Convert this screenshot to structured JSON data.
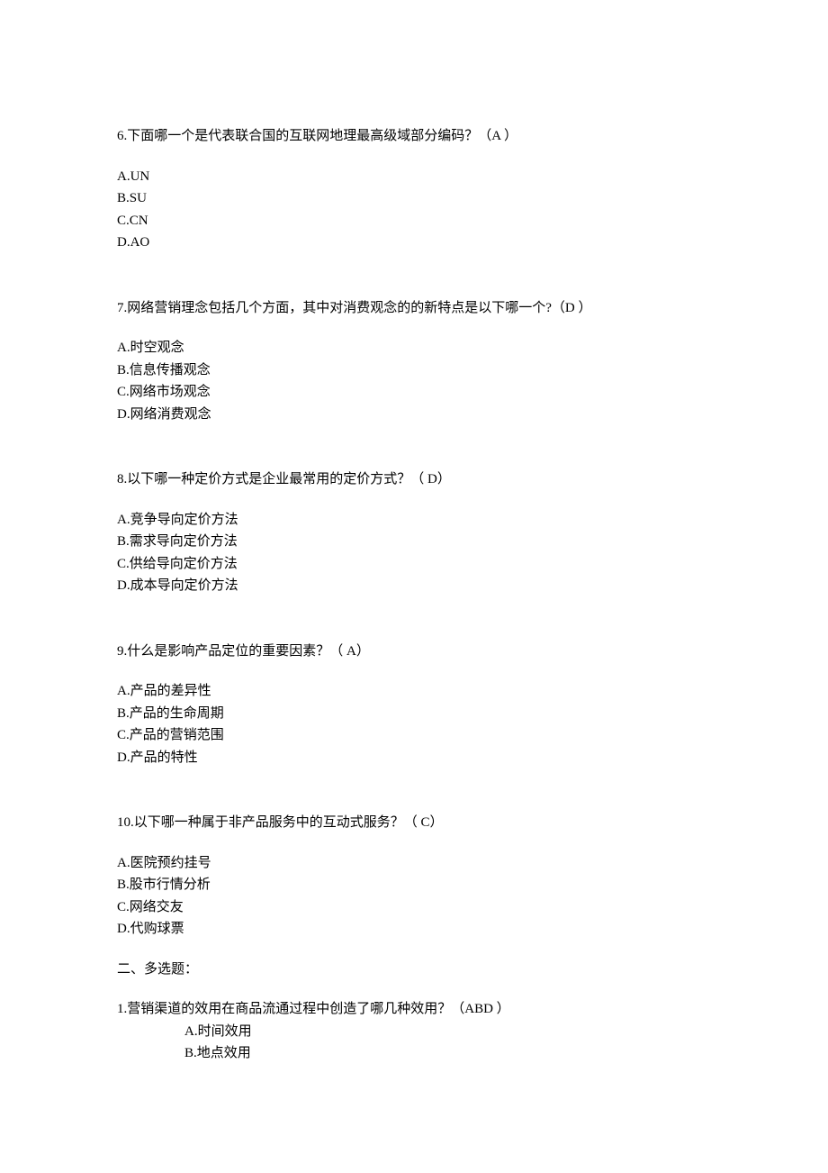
{
  "questions": [
    {
      "text": "6.下面哪一个是代表联合国的互联网地理最高级域部分编码？（A ）",
      "options": [
        "A.UN",
        "B.SU",
        "C.CN",
        "D.AO"
      ]
    },
    {
      "text": "7.网络营销理念包括几个方面，其中对消费观念的的新特点是以下哪一个?（D ）",
      "options": [
        "A.时空观念",
        "B.信息传播观念",
        "C.网络市场观念",
        "D.网络消费观念"
      ]
    },
    {
      "text": "8.以下哪一种定价方式是企业最常用的定价方式？（ D）",
      "options": [
        "A.竞争导向定价方法",
        "B.需求导向定价方法",
        "C.供给导向定价方法",
        "D.成本导向定价方法"
      ]
    },
    {
      "text": "9.什么是影响产品定位的重要因素？（ A）",
      "options": [
        "A.产品的差异性",
        "B.产品的生命周期",
        "C.产品的营销范围",
        "D.产品的特性"
      ]
    },
    {
      "text": "10.以下哪一种属于非产品服务中的互动式服务？（ C）",
      "options": [
        "A.医院预约挂号",
        "B.股市行情分析",
        "C.网络交友",
        "D.代购球票"
      ]
    }
  ],
  "section2": {
    "title": "二、多选题：",
    "question": {
      "text": "1.营销渠道的效用在商品流通过程中创造了哪几种效用？（ABD ）",
      "options": [
        "A.时间效用",
        "B.地点效用"
      ]
    }
  }
}
